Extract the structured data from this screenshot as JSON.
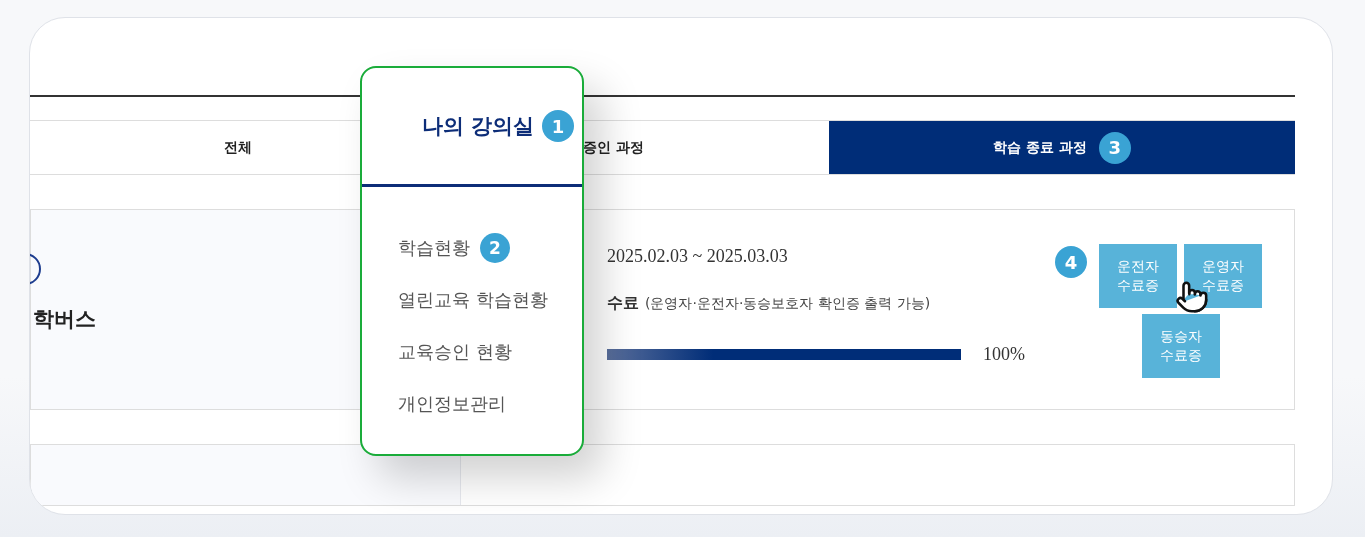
{
  "tabs": [
    {
      "label": "전체",
      "selected": false
    },
    {
      "label": "증인 과정",
      "selected": false
    },
    {
      "label": "학습 종료 과정",
      "selected": true,
      "step": "3"
    }
  ],
  "popup": {
    "title": "나의 강의실",
    "step": "1",
    "items": [
      {
        "label": "학습현황",
        "step": "2"
      },
      {
        "label": "열린교육 학습현황"
      },
      {
        "label": "교육승인 현황"
      },
      {
        "label": "개인정보관리"
      }
    ]
  },
  "course": {
    "title": "학버스",
    "period": "2025.02.03 ~ 2025.03.03",
    "status": "수료",
    "status_note": "(운영자·운전자·동승보호자 확인증 출력 가능)",
    "progress": {
      "level": 1,
      "reading": "100%"
    },
    "step": "4",
    "buttons": [
      "운전자 수료증",
      "운영자 수료증",
      "동승자 수료증"
    ]
  }
}
